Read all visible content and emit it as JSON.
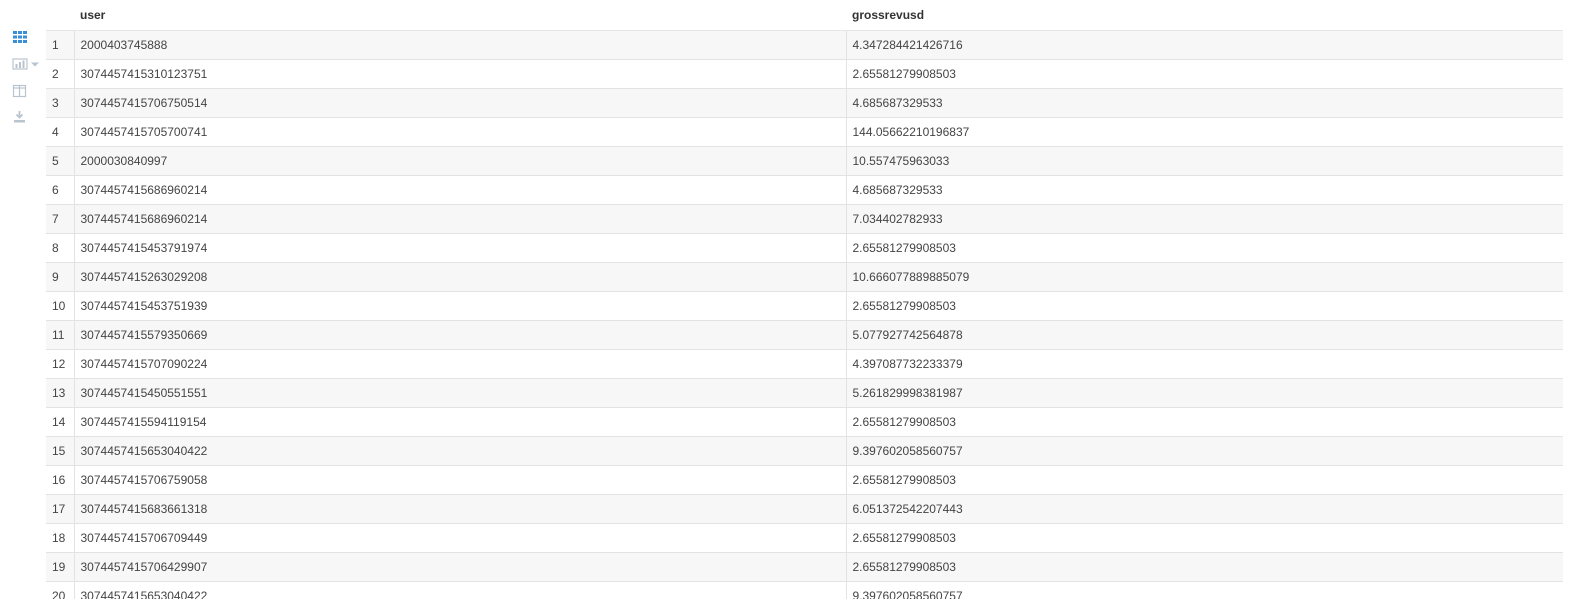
{
  "table": {
    "columns": [
      "",
      "user",
      "grossrevusd"
    ],
    "rows": [
      {
        "index": "1",
        "user": "2000403745888",
        "grossrevusd": "4.347284421426716"
      },
      {
        "index": "2",
        "user": "3074457415310123751",
        "grossrevusd": "2.65581279908503"
      },
      {
        "index": "3",
        "user": "3074457415706750514",
        "grossrevusd": "4.685687329533"
      },
      {
        "index": "4",
        "user": "3074457415705700741",
        "grossrevusd": "144.05662210196837"
      },
      {
        "index": "5",
        "user": "2000030840997",
        "grossrevusd": "10.557475963033"
      },
      {
        "index": "6",
        "user": "3074457415686960214",
        "grossrevusd": "4.685687329533"
      },
      {
        "index": "7",
        "user": "3074457415686960214",
        "grossrevusd": "7.034402782933"
      },
      {
        "index": "8",
        "user": "3074457415453791974",
        "grossrevusd": "2.65581279908503"
      },
      {
        "index": "9",
        "user": "3074457415263029208",
        "grossrevusd": "10.666077889885079"
      },
      {
        "index": "10",
        "user": "3074457415453751939",
        "grossrevusd": "2.65581279908503"
      },
      {
        "index": "11",
        "user": "3074457415579350669",
        "grossrevusd": "5.077927742564878"
      },
      {
        "index": "12",
        "user": "3074457415707090224",
        "grossrevusd": "4.397087732233379"
      },
      {
        "index": "13",
        "user": "3074457415450551551",
        "grossrevusd": "5.261829998381987"
      },
      {
        "index": "14",
        "user": "3074457415594119154",
        "grossrevusd": "2.65581279908503"
      },
      {
        "index": "15",
        "user": "3074457415653040422",
        "grossrevusd": "9.397602058560757"
      },
      {
        "index": "16",
        "user": "3074457415706759058",
        "grossrevusd": "2.65581279908503"
      },
      {
        "index": "17",
        "user": "3074457415683661318",
        "grossrevusd": "6.051372542207443"
      },
      {
        "index": "18",
        "user": "3074457415706709449",
        "grossrevusd": "2.65581279908503"
      },
      {
        "index": "19",
        "user": "3074457415706429907",
        "grossrevusd": "2.65581279908503"
      },
      {
        "index": "20",
        "user": "3074457415653040422",
        "grossrevusd": "9.397602058560757"
      }
    ]
  },
  "toolbar": {
    "icons": [
      "table-grid-icon",
      "bar-chart-icon",
      "columns-icon",
      "download-icon"
    ],
    "active_color": "#3a8fd9",
    "inactive_color": "#b9c4ce"
  }
}
